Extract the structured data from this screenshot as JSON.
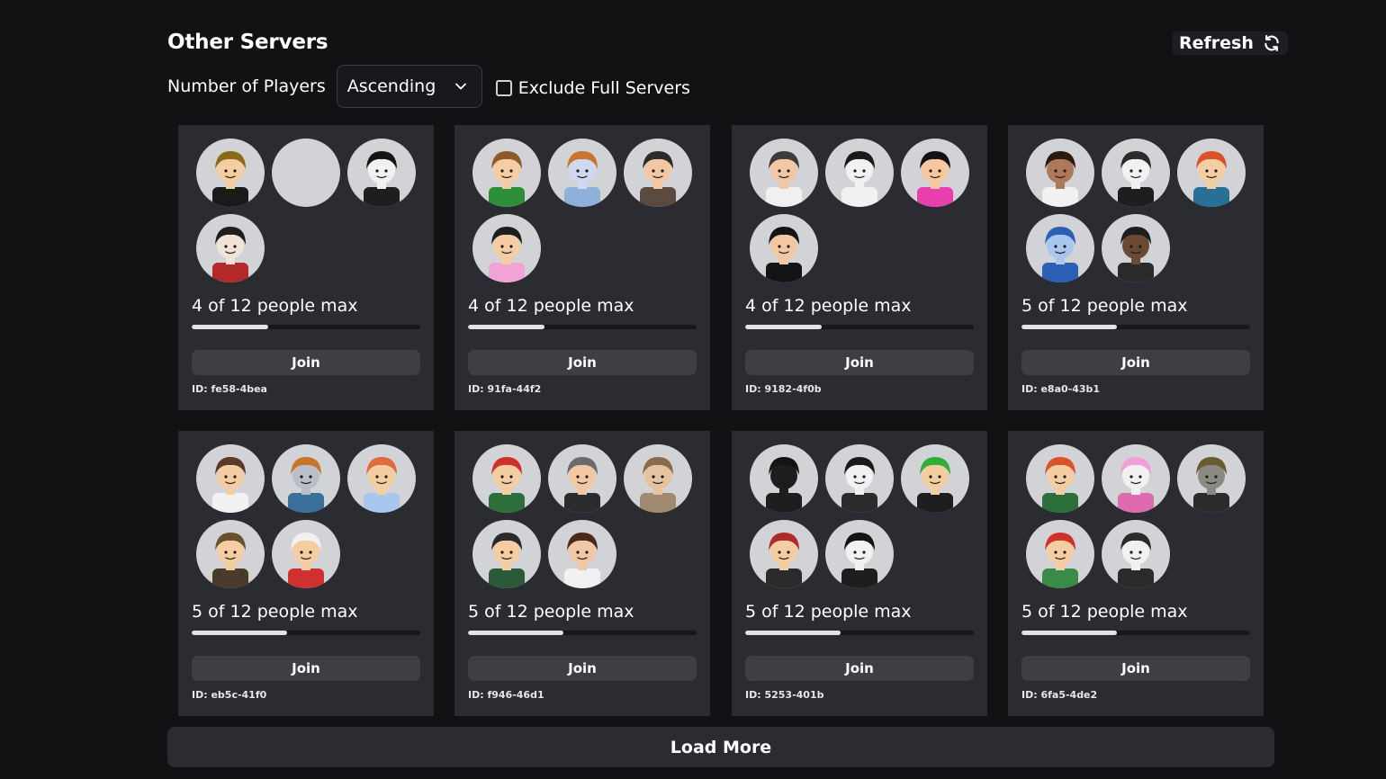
{
  "header": {
    "title": "Other Servers",
    "refresh_label": "Refresh",
    "refresh_icon": "refresh-icon"
  },
  "filters": {
    "sort_label": "Number of Players",
    "sort_selected": "Ascending",
    "sort_icon": "chevron-down-icon",
    "exclude_full_label": "Exclude Full Servers",
    "exclude_full_checked": false
  },
  "join_label": "Join",
  "servers": [
    {
      "count_text": "4 of 12 people max",
      "players": 4,
      "max": 12,
      "id": "ID: fe58-4bea",
      "avatars": [
        {
          "bg": "#d2d3d6",
          "skin": "#f5cda3",
          "hair": "#8a6a14",
          "shirt": "#1a1a1a"
        },
        {
          "bg": "#d2d3d6",
          "skin": "#d2d3d6",
          "hair": "#d2d3d6",
          "shirt": "#d2d3d6"
        },
        {
          "bg": "#d2d3d6",
          "skin": "#f1f1f1",
          "hair": "#141414",
          "shirt": "#1e1e1e"
        },
        {
          "bg": "#d2d3d6",
          "skin": "#f1e3d6",
          "hair": "#1e1e1e",
          "shirt": "#b3282a"
        }
      ]
    },
    {
      "count_text": "4 of 12 people max",
      "players": 4,
      "max": 12,
      "id": "ID: 91fa-44f2",
      "avatars": [
        {
          "bg": "#d2d3d6",
          "skin": "#f5cda3",
          "hair": "#8c5a2a",
          "shirt": "#2d8f3a"
        },
        {
          "bg": "#d2d3d6",
          "skin": "#cfd8ee",
          "hair": "#c7762b",
          "shirt": "#8fb0d8"
        },
        {
          "bg": "#d2d3d6",
          "skin": "#f2c7a3",
          "hair": "#2b2b2b",
          "shirt": "#5a4a40"
        },
        {
          "bg": "#d2d3d6",
          "skin": "#f5cda3",
          "hair": "#1e1e1e",
          "shirt": "#f2a3d6"
        }
      ]
    },
    {
      "count_text": "4 of 12 people max",
      "players": 4,
      "max": 12,
      "id": "ID: 9182-4f0b",
      "avatars": [
        {
          "bg": "#d2d3d6",
          "skin": "#f2c7a3",
          "hair": "#3c3c3c",
          "shirt": "#f0f0f0"
        },
        {
          "bg": "#d2d3d6",
          "skin": "#f1f1f1",
          "hair": "#1a1a1a",
          "shirt": "#f1f1f1"
        },
        {
          "bg": "#d2d3d6",
          "skin": "#f7c8a0",
          "hair": "#121212",
          "shirt": "#e83fae"
        },
        {
          "bg": "#d2d3d6",
          "skin": "#f2c7a3",
          "hair": "#141414",
          "shirt": "#141414"
        }
      ]
    },
    {
      "count_text": "5 of 12 people max",
      "players": 5,
      "max": 12,
      "id": "ID: e8a0-43b1",
      "avatars": [
        {
          "bg": "#d2d3d6",
          "skin": "#b0785a",
          "hair": "#2a1a12",
          "shirt": "#f1f1f1"
        },
        {
          "bg": "#d2d3d6",
          "skin": "#f1f1f1",
          "hair": "#2b2b2b",
          "shirt": "#1e1e1e"
        },
        {
          "bg": "#d2d3d6",
          "skin": "#f5cda3",
          "hair": "#d9522a",
          "shirt": "#2a6f95"
        },
        {
          "bg": "#d2d3d6",
          "skin": "#a9c6ee",
          "hair": "#2a5fb5",
          "shirt": "#2a5fb5"
        },
        {
          "bg": "#d2d3d6",
          "skin": "#6a4a34",
          "hair": "#1e1e1e",
          "shirt": "#2a2a2a"
        }
      ]
    },
    {
      "count_text": "5 of 12 people max",
      "players": 5,
      "max": 12,
      "id": "ID: eb5c-41f0",
      "avatars": [
        {
          "bg": "#d2d3d6",
          "skin": "#f5cda3",
          "hair": "#5a3a28",
          "shirt": "#f1f1f1"
        },
        {
          "bg": "#d2d3d6",
          "skin": "#b9bec8",
          "hair": "#c7762b",
          "shirt": "#3a6f9a"
        },
        {
          "bg": "#d2d3d6",
          "skin": "#f5cda3",
          "hair": "#e06a3a",
          "shirt": "#a9c6ee"
        },
        {
          "bg": "#d2d3d6",
          "skin": "#f5cda3",
          "hair": "#6a5030",
          "shirt": "#4a3a2a"
        },
        {
          "bg": "#d2d3d6",
          "skin": "#f5cda3",
          "hair": "#f1f1f1",
          "shirt": "#d03030"
        }
      ]
    },
    {
      "count_text": "5 of 12 people max",
      "players": 5,
      "max": 12,
      "id": "ID: f946-46d1",
      "avatars": [
        {
          "bg": "#d2d3d6",
          "skin": "#f5cda3",
          "hair": "#d0302a",
          "shirt": "#2d6f3a"
        },
        {
          "bg": "#d2d3d6",
          "skin": "#f2c7a3",
          "hair": "#6a6a6a",
          "shirt": "#2b2b2b"
        },
        {
          "bg": "#d2d3d6",
          "skin": "#e6c2a0",
          "hair": "#8a6a4a",
          "shirt": "#a08a70"
        },
        {
          "bg": "#d2d3d6",
          "skin": "#f5cda3",
          "hair": "#2a2a2a",
          "shirt": "#2a5a3a"
        },
        {
          "bg": "#d2d3d6",
          "skin": "#f2c7a3",
          "hair": "#4a2a1a",
          "shirt": "#f1f1f1"
        }
      ]
    },
    {
      "count_text": "5 of 12 people max",
      "players": 5,
      "max": 12,
      "id": "ID: 5253-401b",
      "avatars": [
        {
          "bg": "#d2d3d6",
          "skin": "#1e1e1e",
          "hair": "#141414",
          "shirt": "#1e1e1e"
        },
        {
          "bg": "#d2d3d6",
          "skin": "#f1f1f1",
          "hair": "#1a1a1a",
          "shirt": "#2b2b2b"
        },
        {
          "bg": "#d2d3d6",
          "skin": "#f5cda3",
          "hair": "#2fae3a",
          "shirt": "#1e1e1e"
        },
        {
          "bg": "#d2d3d6",
          "skin": "#f5cda3",
          "hair": "#b02a2a",
          "shirt": "#2b2b2b"
        },
        {
          "bg": "#d2d3d6",
          "skin": "#f1f1f1",
          "hair": "#141414",
          "shirt": "#1e1e1e"
        }
      ]
    },
    {
      "count_text": "5 of 12 people max",
      "players": 5,
      "max": 12,
      "id": "ID: 6fa5-4de2",
      "avatars": [
        {
          "bg": "#d2d3d6",
          "skin": "#f5cda3",
          "hair": "#d9522a",
          "shirt": "#2d6f3a"
        },
        {
          "bg": "#d2d3d6",
          "skin": "#f1f1f1",
          "hair": "#f0a0d8",
          "shirt": "#e06ab0"
        },
        {
          "bg": "#d2d3d6",
          "skin": "#8a8a80",
          "hair": "#6a5a30",
          "shirt": "#2b2b2b"
        },
        {
          "bg": "#d2d3d6",
          "skin": "#f5cda3",
          "hair": "#d0302a",
          "shirt": "#3a8a4a"
        },
        {
          "bg": "#d2d3d6",
          "skin": "#f1f1f1",
          "hair": "#2b2b2b",
          "shirt": "#2b2b2b"
        }
      ]
    }
  ],
  "load_more_label": "Load More"
}
